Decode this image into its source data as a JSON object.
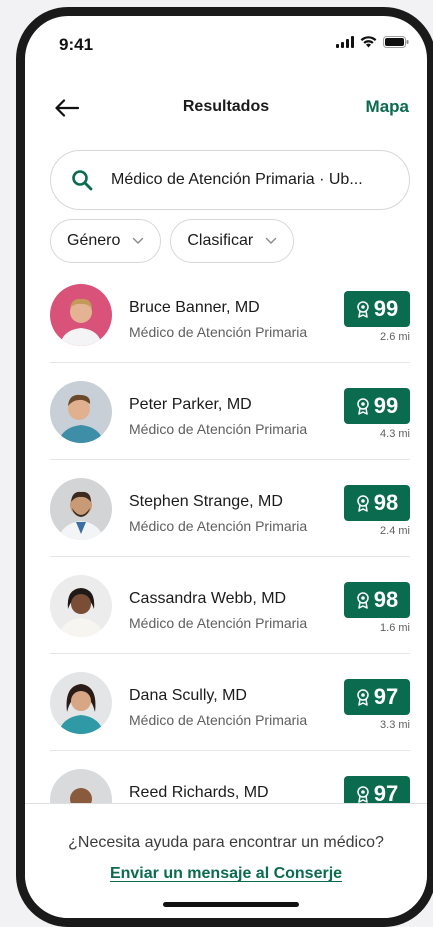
{
  "status_bar": {
    "time": "9:41"
  },
  "nav": {
    "title": "Resultados",
    "map_label": "Mapa"
  },
  "search": {
    "value": "Médico de Atención Primaria · Ub..."
  },
  "filters": [
    {
      "label": "Género"
    },
    {
      "label": "Clasificar"
    }
  ],
  "providers": [
    {
      "name": "Bruce Banner, MD",
      "specialty": "Médico de Atención Primaria",
      "score": "99",
      "distance": "2.6 mi"
    },
    {
      "name": "Peter Parker, MD",
      "specialty": "Médico de Atención Primaria",
      "score": "99",
      "distance": "4.3 mi"
    },
    {
      "name": "Stephen Strange, MD",
      "specialty": "Médico de Atención Primaria",
      "score": "98",
      "distance": "2.4 mi"
    },
    {
      "name": "Cassandra Webb, MD",
      "specialty": "Médico de Atención Primaria",
      "score": "98",
      "distance": "1.6 mi"
    },
    {
      "name": "Dana Scully, MD",
      "specialty": "Médico de Atención Primaria",
      "score": "97",
      "distance": "3.3 mi"
    },
    {
      "name": "Reed Richards, MD",
      "specialty": "",
      "score": "97",
      "distance": ""
    }
  ],
  "footer": {
    "help_text": "¿Necesita ayuda para encontrar un médico?",
    "concierge_link": "Enviar un mensaje al Conserje"
  },
  "colors": {
    "accent": "#0b6b4e",
    "text": "#1b1b1b",
    "muted": "#5f5f5f"
  }
}
